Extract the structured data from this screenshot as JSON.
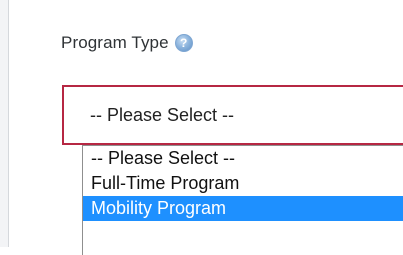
{
  "form": {
    "program_type_label": "Program Type",
    "help_icon": "help-question-icon",
    "select": {
      "selected_value": "-- Please Select --"
    },
    "dropdown": {
      "options": [
        "-- Please Select --",
        "Full-Time Program",
        "Mobility Program"
      ],
      "highlighted_option": "Mobility Program"
    }
  },
  "colors": {
    "select_border": "#b62743",
    "highlight_bg": "#1e90ff",
    "highlight_text": "#ffffff"
  }
}
